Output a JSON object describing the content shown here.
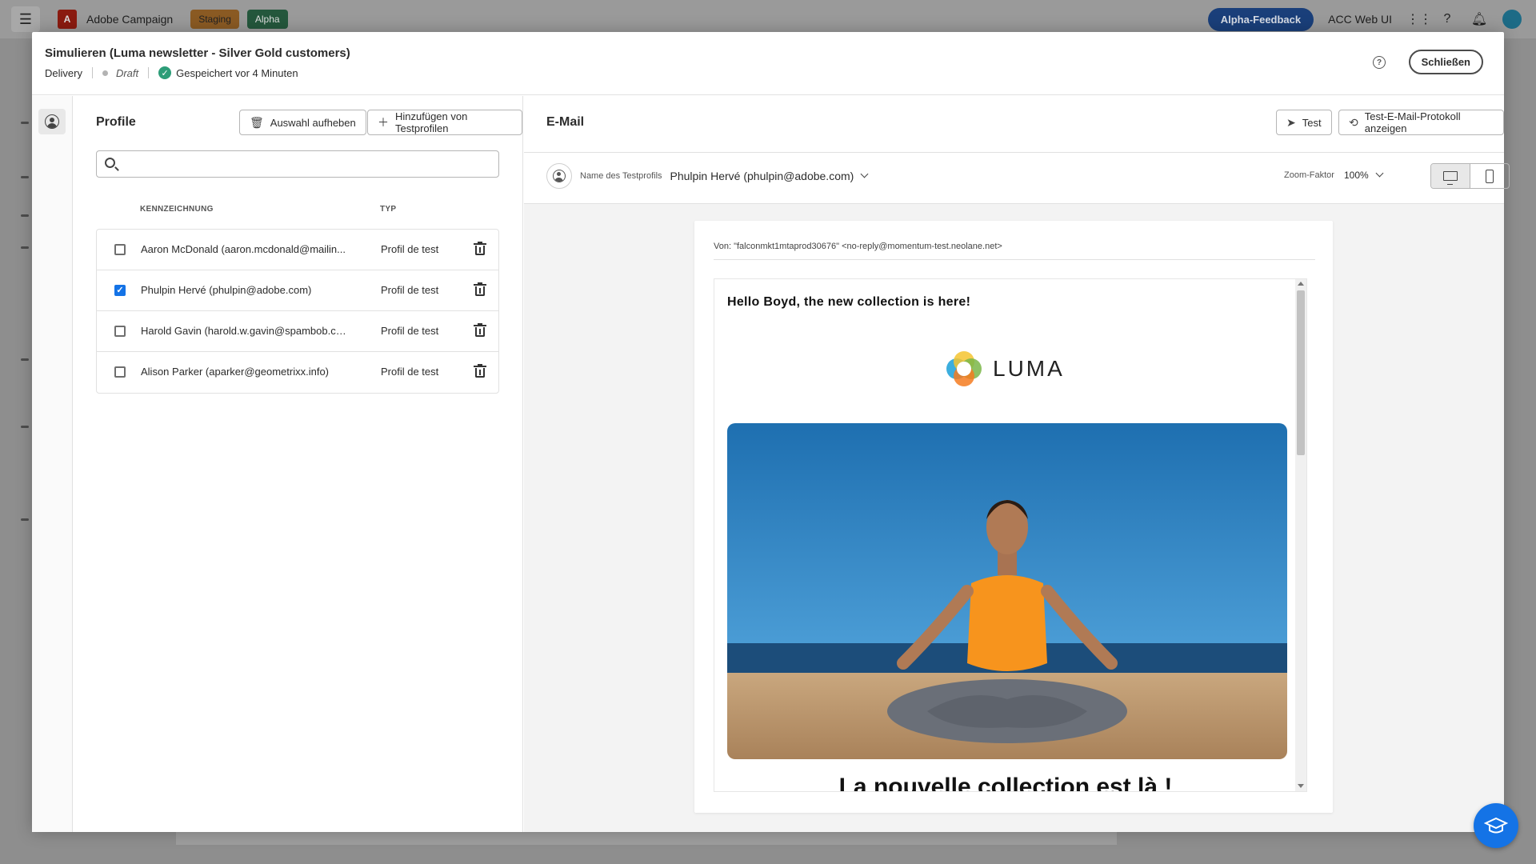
{
  "app": {
    "name": "Adobe Campaign",
    "badges": [
      "Staging",
      "Alpha"
    ],
    "feedback_label": "Alpha-Feedback",
    "instance_label": "ACC Web UI"
  },
  "modal": {
    "title": "Simulieren (Luma newsletter - Silver Gold customers)",
    "type_label": "Delivery",
    "status_label": "Draft",
    "saved_label": "Gespeichert vor 4 Minuten",
    "close_label": "Schließen"
  },
  "profiles": {
    "title": "Profile",
    "clear_selection_label": "Auswahl aufheben",
    "add_test_profiles_label": "Hinzufügen von Testprofilen",
    "search_placeholder": "",
    "columns": {
      "name": "KENNZEICHNUNG",
      "type": "TYP"
    },
    "rows": [
      {
        "name": "Aaron McDonald (aaron.mcdonald@mailin...",
        "type": "Profil de test",
        "checked": false
      },
      {
        "name": "Phulpin Hervé (phulpin@adobe.com)",
        "type": "Profil de test",
        "checked": true
      },
      {
        "name": "Harold Gavin (harold.w.gavin@spambob.com)",
        "type": "Profil de test",
        "checked": false
      },
      {
        "name": "Alison Parker (aparker@geometrixx.info)",
        "type": "Profil de test",
        "checked": false
      }
    ]
  },
  "email": {
    "title": "E-Mail",
    "test_label": "Test",
    "log_label": "Test-E-Mail-Protokoll anzeigen",
    "profile_name_label": "Name des Testprofils",
    "profile_name_value": "Phulpin Hervé (phulpin@adobe.com)",
    "zoom_label": "Zoom-Faktor",
    "zoom_value": "100%",
    "from": "Von: \"falconmkt1mtaprod30676\" <no-reply@momentum-test.neolane.net>",
    "greeting": "Hello Boyd, the new collection is here!",
    "brand": "LUMA",
    "headline": "La nouvelle collection est là !"
  },
  "colors": {
    "accent": "#1473e6",
    "success": "#2d9d78"
  }
}
